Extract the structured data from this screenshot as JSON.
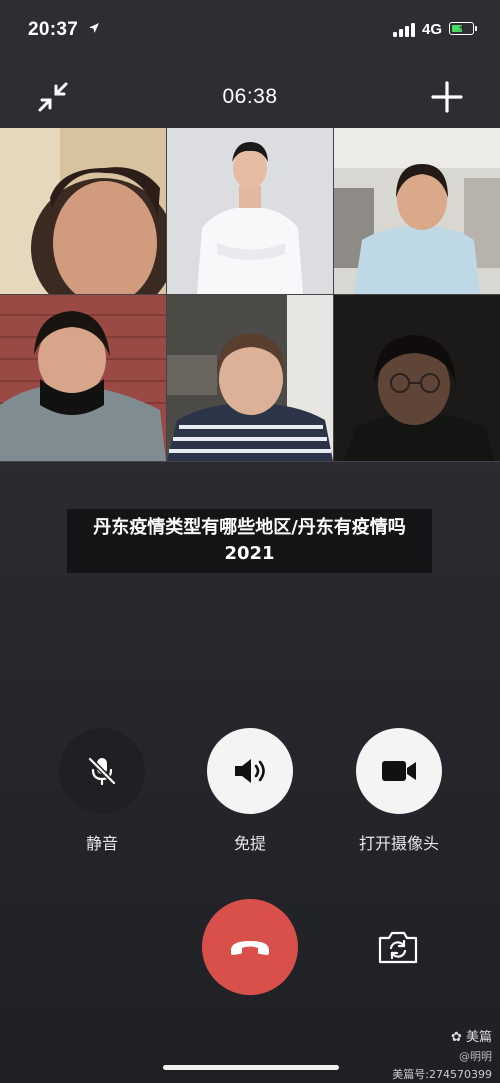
{
  "status_bar": {
    "time": "20:37",
    "network": "4G",
    "battery_level": 0.55,
    "battery_color": "#4cd964"
  },
  "call": {
    "duration": "06:38",
    "collapse_icon": "collapse-arrows-icon",
    "add_icon": "plus-icon"
  },
  "participants": [
    {
      "name": ""
    },
    {
      "name": ""
    },
    {
      "name": ""
    },
    {
      "name": ""
    },
    {
      "name": ""
    },
    {
      "name": ""
    }
  ],
  "caption": {
    "text": "丹东疫情类型有哪些地区/丹东有疫情吗2021"
  },
  "controls": {
    "mute_label": "静音",
    "speaker_label": "免提",
    "camera_label": "打开摄像头"
  },
  "hangup": {
    "color": "#d9504b",
    "icon": "phone-hangup-icon"
  },
  "watermark": {
    "logo": "美篇",
    "author": "@明明",
    "id": "美篇号:274570399"
  }
}
